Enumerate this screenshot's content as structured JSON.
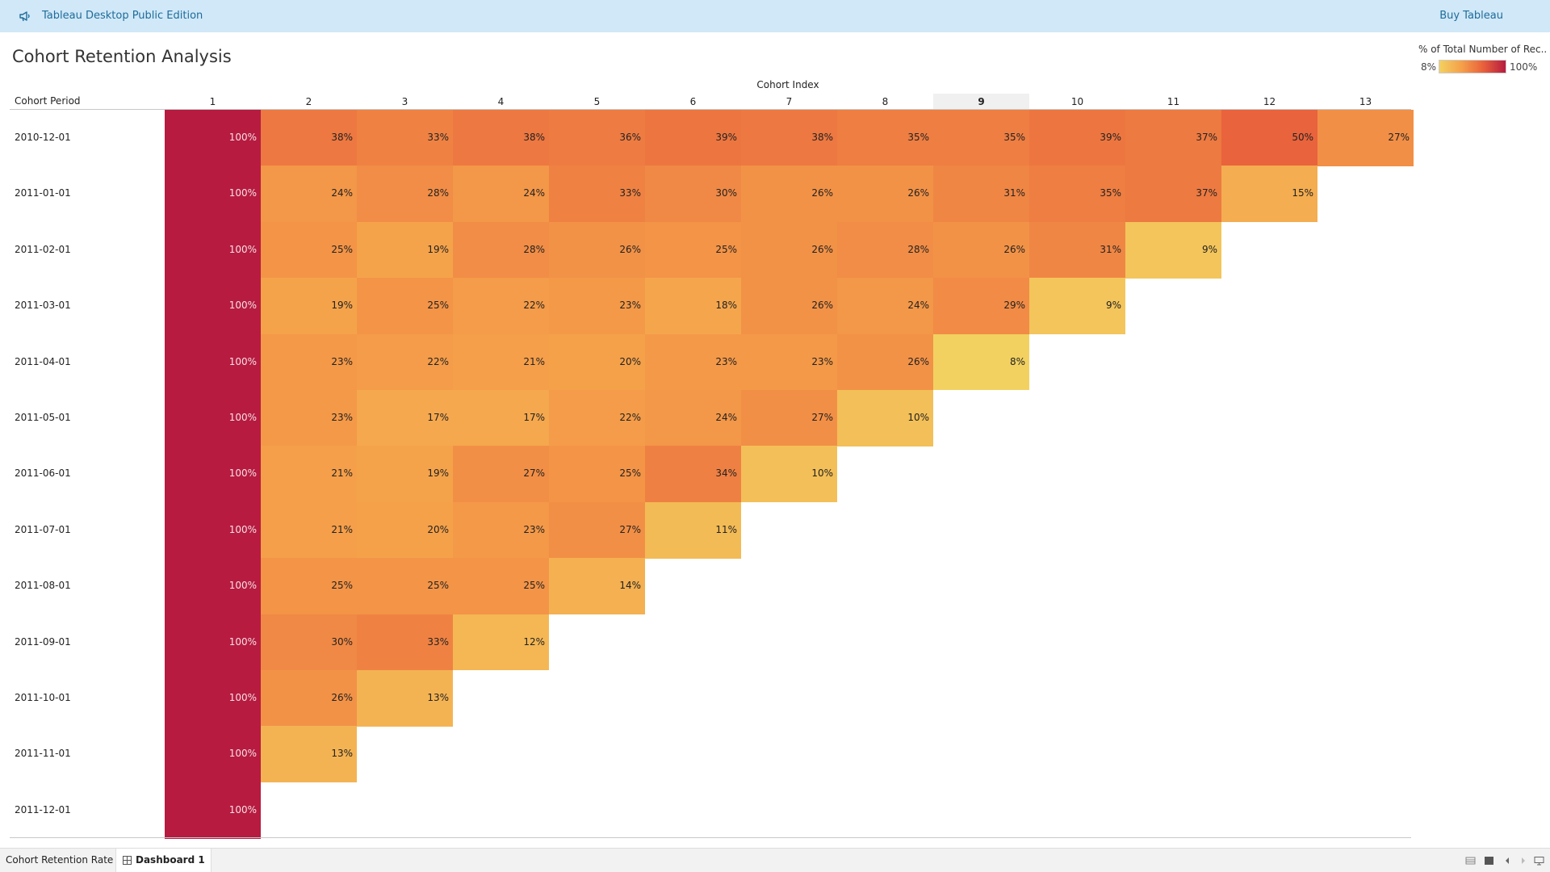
{
  "topbar": {
    "product": "Tableau Desktop Public Edition",
    "buy_label": "Buy Tableau",
    "icon": "megaphone-icon"
  },
  "dashboard": {
    "title": "Cohort Retention Analysis"
  },
  "legend": {
    "title": "% of Total Number of Rec..",
    "min_label": "8%",
    "max_label": "100%",
    "colors": [
      "#f2d160",
      "#f5a04a",
      "#e8603b",
      "#b71b40"
    ]
  },
  "chart_data": {
    "type": "heatmap",
    "title": "",
    "column_axis_title": "Cohort Index",
    "row_axis_title": "Cohort Period",
    "columns": [
      "1",
      "2",
      "3",
      "4",
      "5",
      "6",
      "7",
      "8",
      "9",
      "10",
      "11",
      "12",
      "13"
    ],
    "selected_column": "9",
    "rows": [
      "2010-12-01",
      "2011-01-01",
      "2011-02-01",
      "2011-03-01",
      "2011-04-01",
      "2011-05-01",
      "2011-06-01",
      "2011-07-01",
      "2011-08-01",
      "2011-09-01",
      "2011-10-01",
      "2011-11-01",
      "2011-12-01"
    ],
    "values": [
      [
        100,
        38,
        33,
        38,
        36,
        39,
        38,
        35,
        35,
        39,
        37,
        50,
        27
      ],
      [
        100,
        24,
        28,
        24,
        33,
        30,
        26,
        26,
        31,
        35,
        37,
        15
      ],
      [
        100,
        25,
        19,
        28,
        26,
        25,
        26,
        28,
        26,
        31,
        9
      ],
      [
        100,
        19,
        25,
        22,
        23,
        18,
        26,
        24,
        29,
        9
      ],
      [
        100,
        23,
        22,
        21,
        20,
        23,
        23,
        26,
        8
      ],
      [
        100,
        23,
        17,
        17,
        22,
        24,
        27,
        10
      ],
      [
        100,
        21,
        19,
        27,
        25,
        34,
        10
      ],
      [
        100,
        21,
        20,
        23,
        27,
        11
      ],
      [
        100,
        25,
        25,
        25,
        14
      ],
      [
        100,
        30,
        33,
        12
      ],
      [
        100,
        26,
        13
      ],
      [
        100,
        13
      ],
      [
        100
      ]
    ],
    "value_suffix": "%",
    "color_range": [
      8,
      100
    ]
  },
  "tabs": [
    {
      "label": "Cohort Retention Rate"
    },
    {
      "label": "Dashboard 1"
    }
  ],
  "controls": [
    "sheet-view-icon",
    "presentation-icon",
    "prev-icon",
    "next-icon",
    "present-mode-icon"
  ]
}
